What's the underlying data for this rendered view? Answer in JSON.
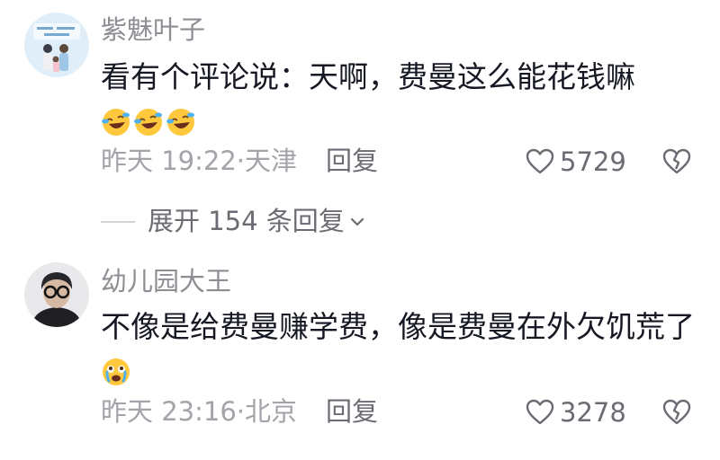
{
  "comments": [
    {
      "username": "紫魅叶子",
      "text": "看有个评论说：天啊，费曼这么能花钱嘛",
      "emojis": [
        "laugh-cry-emoji",
        "laugh-cry-emoji",
        "laugh-cry-emoji"
      ],
      "meta": "昨天 19:22·天津",
      "reply_label": "回复",
      "likes": "5729"
    },
    {
      "username": "幼儿园大王",
      "text": "不像是给费曼赚学费，像是费曼在外欠饥荒了",
      "emojis": [
        "teary-face-emoji"
      ],
      "meta": "昨天 23:16·北京",
      "reply_label": "回复",
      "likes": "3278"
    }
  ],
  "expand_replies": "展开 154 条回复",
  "colors": {
    "username": "#8d8d94",
    "meta": "#a3a3aa",
    "text": "#161823",
    "emoji_yellow": "#ffc83d"
  }
}
